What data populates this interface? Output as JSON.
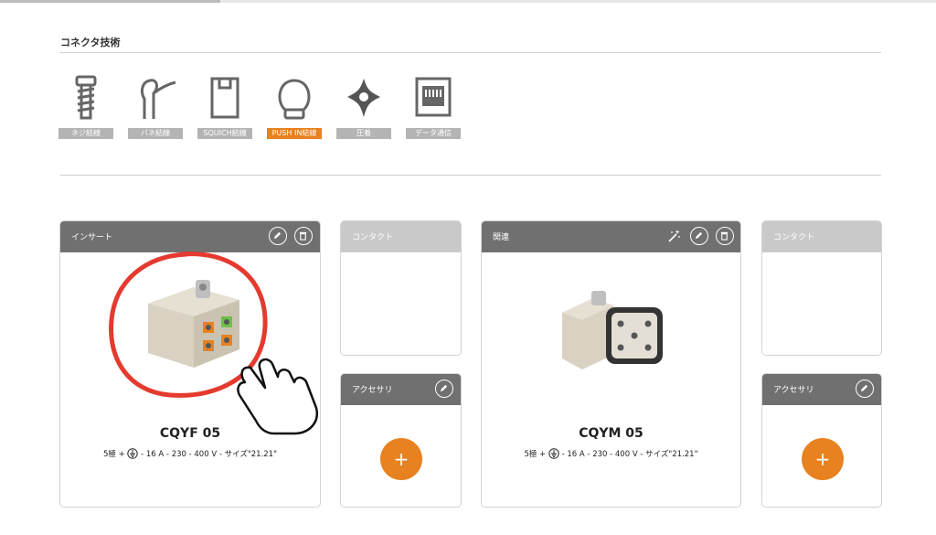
{
  "progress": {
    "fraction": 0.235
  },
  "section": {
    "title": "コネクタ技術"
  },
  "technologies": [
    {
      "label": "ネジ結線",
      "icon": "screw-icon",
      "active": false
    },
    {
      "label": "バネ結線",
      "icon": "spring-clamp-icon",
      "active": false
    },
    {
      "label": "SQUICH結線",
      "icon": "squich-icon",
      "active": false
    },
    {
      "label": "PUSH IN結線",
      "icon": "push-in-icon",
      "active": true
    },
    {
      "label": "圧着",
      "icon": "crimp-icon",
      "active": false
    },
    {
      "label": "データ通信",
      "icon": "data-port-icon",
      "active": false
    }
  ],
  "insert_card": {
    "header": "インサート",
    "product_name": "CQYF 05",
    "spec_prefix": "5極 +",
    "spec_suffix": "- 16 A - 230 - 400 V - サイズ\"21.21\"",
    "icons": [
      "edit-icon",
      "trash-icon"
    ]
  },
  "contact_card_1": {
    "header": "コンタクト"
  },
  "accessory_card_1": {
    "header": "アクセサリ",
    "add_label": "+",
    "icons": [
      "edit-icon"
    ]
  },
  "related_card": {
    "header": "関連",
    "product_name": "CQYM 05",
    "spec_prefix": "5極 +",
    "spec_suffix": "- 16 A - 230 - 400 V - サイズ\"21.21\"",
    "icons": [
      "magic-wand-icon",
      "edit-icon",
      "trash-icon"
    ]
  },
  "contact_card_2": {
    "header": "コンタクト"
  },
  "accessory_card_2": {
    "header": "アクセサリ",
    "add_label": "+",
    "icons": [
      "edit-icon"
    ]
  },
  "colors": {
    "accent": "#e8811f",
    "header_dark": "#707070",
    "header_light": "#c9c9c9",
    "highlight_circle": "#e53a2f"
  }
}
